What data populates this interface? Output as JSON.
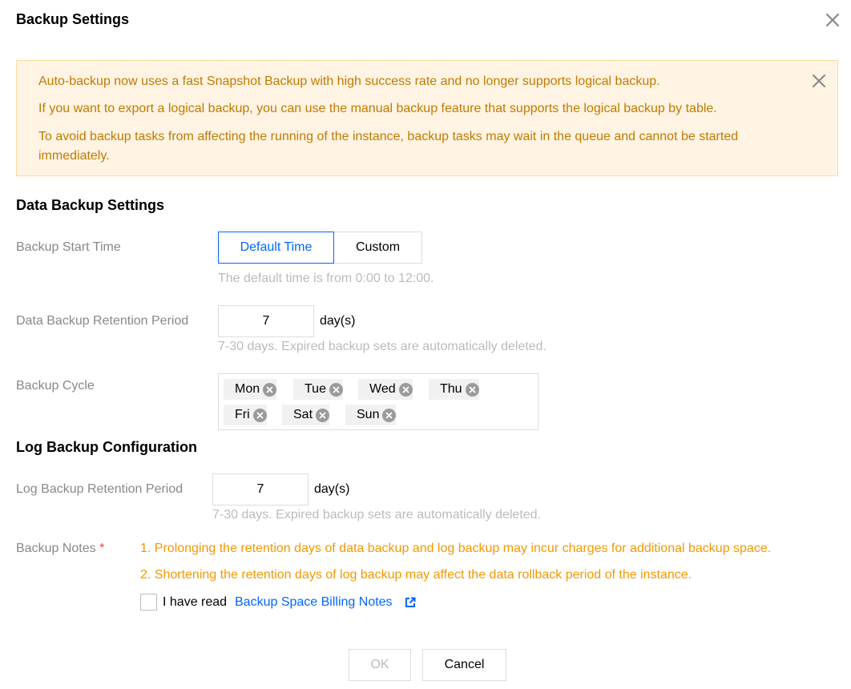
{
  "dialog": {
    "title": "Backup Settings"
  },
  "alert": {
    "line1": "Auto-backup now uses a fast Snapshot Backup with high success rate and no longer supports logical backup.",
    "line2": "If you want to export a logical backup, you can use the manual backup feature that supports the logical backup by table.",
    "line3": "To avoid backup tasks from affecting the running of the instance, backup tasks may wait in the queue and cannot be started immediately."
  },
  "data_backup": {
    "heading": "Data Backup Settings",
    "start_time": {
      "label": "Backup Start Time",
      "options": [
        "Default Time",
        "Custom"
      ],
      "selected": "Default Time",
      "hint": "The default time is from 0:00 to 12:00."
    },
    "retention": {
      "label": "Data Backup Retention Period",
      "value": "7",
      "unit": "day(s)",
      "hint": "7-30 days. Expired backup sets are automatically deleted."
    },
    "cycle": {
      "label": "Backup Cycle",
      "days": [
        "Mon",
        "Tue",
        "Wed",
        "Thu",
        "Fri",
        "Sat",
        "Sun"
      ]
    }
  },
  "log_backup": {
    "heading": "Log Backup Configuration",
    "retention": {
      "label": "Log Backup Retention Period",
      "value": "7",
      "unit": "day(s)",
      "hint": "7-30 days. Expired backup sets are automatically deleted."
    }
  },
  "notes": {
    "label": "Backup Notes",
    "required_mark": "*",
    "note1": "1. Prolonging the retention days of data backup and log backup may incur charges for additional backup space.",
    "note2": "2. Shortening the retention days of log backup may affect the data rollback period of the instance.",
    "agree_text": "I have read",
    "agree_checked": false,
    "link_text": "Backup Space Billing Notes"
  },
  "footer": {
    "ok_label": "OK",
    "ok_disabled": true,
    "cancel_label": "Cancel"
  },
  "colors": {
    "primary": "#0066ff",
    "warning_text": "#c17a00",
    "warning_bg": "#fff4e3",
    "note_text": "#f39800",
    "required": "#e54545"
  }
}
